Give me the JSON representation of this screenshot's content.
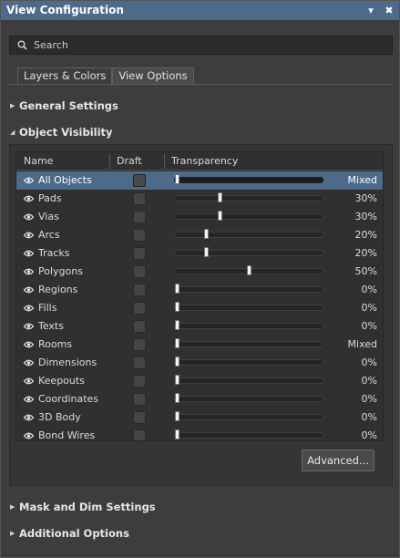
{
  "window": {
    "title": "View Configuration",
    "pin_glyph": "▾",
    "close_glyph": "✖"
  },
  "search": {
    "placeholder": "Search"
  },
  "tabs": [
    {
      "label": "Layers & Colors",
      "active": false
    },
    {
      "label": "View Options",
      "active": true
    }
  ],
  "sections": {
    "general_settings": "General Settings",
    "object_visibility": "Object Visibility",
    "mask_dim": "Mask and Dim Settings",
    "additional_options": "Additional Options"
  },
  "table": {
    "columns": {
      "name": "Name",
      "draft": "Draft",
      "transparency": "Transparency"
    },
    "rows": [
      {
        "name": "All Objects",
        "draft": false,
        "transparency": 0,
        "value_label": "Mixed",
        "selected": true
      },
      {
        "name": "Pads",
        "draft": false,
        "transparency": 30,
        "value_label": "30%",
        "selected": false
      },
      {
        "name": "Vias",
        "draft": false,
        "transparency": 30,
        "value_label": "30%",
        "selected": false
      },
      {
        "name": "Arcs",
        "draft": false,
        "transparency": 20,
        "value_label": "20%",
        "selected": false
      },
      {
        "name": "Tracks",
        "draft": false,
        "transparency": 20,
        "value_label": "20%",
        "selected": false
      },
      {
        "name": "Polygons",
        "draft": false,
        "transparency": 50,
        "value_label": "50%",
        "selected": false
      },
      {
        "name": "Regions",
        "draft": false,
        "transparency": 0,
        "value_label": "0%",
        "selected": false
      },
      {
        "name": "Fills",
        "draft": false,
        "transparency": 0,
        "value_label": "0%",
        "selected": false
      },
      {
        "name": "Texts",
        "draft": false,
        "transparency": 0,
        "value_label": "0%",
        "selected": false
      },
      {
        "name": "Rooms",
        "draft": false,
        "transparency": 0,
        "value_label": "Mixed",
        "selected": false
      },
      {
        "name": "Dimensions",
        "draft": false,
        "transparency": 0,
        "value_label": "0%",
        "selected": false
      },
      {
        "name": "Keepouts",
        "draft": false,
        "transparency": 0,
        "value_label": "0%",
        "selected": false
      },
      {
        "name": "Coordinates",
        "draft": false,
        "transparency": 0,
        "value_label": "0%",
        "selected": false
      },
      {
        "name": "3D Body",
        "draft": false,
        "transparency": 0,
        "value_label": "0%",
        "selected": false
      },
      {
        "name": "Bond Wires",
        "draft": false,
        "transparency": 0,
        "value_label": "0%",
        "selected": false
      }
    ]
  },
  "advanced_button": {
    "label": "Advanced..."
  },
  "colors": {
    "titlebar": "#4d6a8a",
    "selection": "#4d6a8a",
    "panel": "#3d3d3d"
  },
  "icons": {
    "search": "search-icon",
    "visibility": "eye-icon",
    "collapsed": "triangle-right-icon",
    "expanded": "triangle-down-icon"
  }
}
